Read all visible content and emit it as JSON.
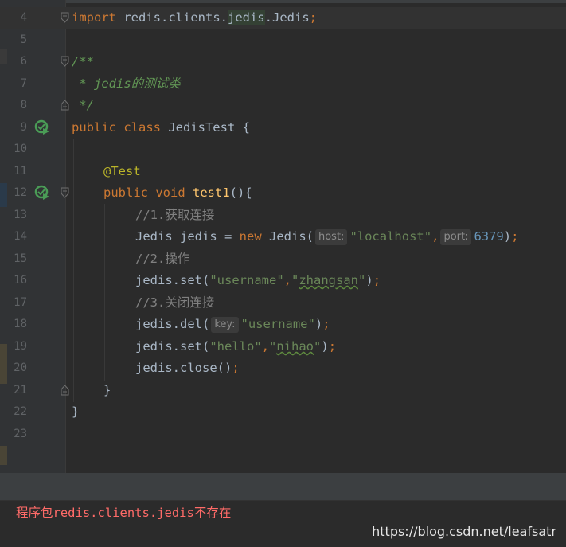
{
  "lines": [
    {
      "num": "4",
      "code": "import redis.clients.jedis.Jedis;"
    },
    {
      "num": "5",
      "code": ""
    },
    {
      "num": "6",
      "code": "/**"
    },
    {
      "num": "7",
      "code": " * jedis的测试类"
    },
    {
      "num": "8",
      "code": " */"
    },
    {
      "num": "9",
      "code": "public class JedisTest {"
    },
    {
      "num": "10",
      "code": ""
    },
    {
      "num": "11",
      "code": "    @Test"
    },
    {
      "num": "12",
      "code": "    public void test1(){"
    },
    {
      "num": "13",
      "code": "        //1.获取连接"
    },
    {
      "num": "14",
      "code": "        Jedis jedis = new Jedis(host: \"localhost\", port: 6379);"
    },
    {
      "num": "15",
      "code": "        //2.操作"
    },
    {
      "num": "16",
      "code": "        jedis.set(\"username\",\"zhangsan\");"
    },
    {
      "num": "17",
      "code": "        //3.关闭连接"
    },
    {
      "num": "18",
      "code": "        jedis.del(key: \"username\");"
    },
    {
      "num": "19",
      "code": "        jedis.set(\"hello\",\"nihao\");"
    },
    {
      "num": "20",
      "code": "        jedis.close();"
    },
    {
      "num": "21",
      "code": "    }"
    },
    {
      "num": "22",
      "code": "}"
    },
    {
      "num": "23",
      "code": ""
    }
  ],
  "tokens": {
    "import_kw": "import",
    "import_path_1": " redis.clients.",
    "import_path_2": "jedis",
    "import_path_3": ".Jedis",
    "semicolon": ";",
    "doc_open": "/**",
    "doc_line": " * jedis的测试类",
    "doc_close": " */",
    "public_class": "public class",
    "class_name": " JedisTest {",
    "annotation": "@Test",
    "public_void": "public void",
    "method_name": "test1",
    "method_parens": "(){",
    "comment1": "//1.获取连接",
    "jedis_decl": "Jedis jedis = ",
    "new_kw": "new",
    "jedis_ctor": " Jedis(",
    "hint_host": "host:",
    "str_localhost": "\"localhost\"",
    "comma": ",",
    "hint_port": "port:",
    "num_port": "6379",
    "close_paren": ")",
    "comment2": "//2.操作",
    "set_call": "jedis.set(",
    "str_username": "\"username\"",
    "quote": "\"",
    "word_zhangsan": "zhangsan",
    "comment3": "//3.关闭连接",
    "del_call": "jedis.del(",
    "hint_key": "key:",
    "str_hello": "\"hello\"",
    "word_nihao": "nihao",
    "close_call": "jedis.close()",
    "brace_close": "}"
  },
  "error_message_prefix": "程序包",
  "error_message_mono": "redis.clients.jedis",
  "error_message_suffix": "不存在",
  "watermark": "https://blog.csdn.net/leafsatr",
  "colors": {
    "background": "#2b2b2b",
    "keyword": "#cc7832",
    "string": "#6a8759",
    "number": "#6897bb",
    "comment": "#808080",
    "doc_comment": "#629755",
    "annotation": "#bbb529",
    "method_decl": "#ffc66d",
    "error": "#ff6b68",
    "run_icon": "#4a9c56"
  },
  "icons": {
    "run_line_9": "run-test-icon",
    "run_line_12": "run-test-icon"
  }
}
